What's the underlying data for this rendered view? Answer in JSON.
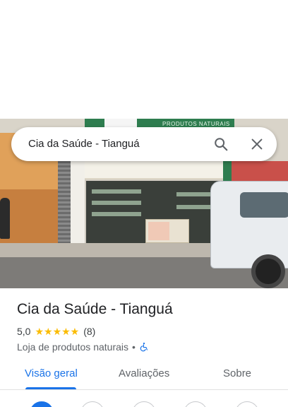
{
  "search": {
    "query": "Cia da Saúde - Tianguá",
    "search_icon": "search-icon",
    "close_icon": "close-icon"
  },
  "hero": {
    "storefront_sign": "PRODUTOS NATURAIS"
  },
  "place": {
    "title": "Cia da Saúde - Tianguá",
    "rating": "5,0",
    "stars": "★★★★★",
    "review_count": "(8)",
    "category": "Loja de produtos naturais",
    "separator": "•",
    "accessibility_icon": "wheelchair-icon"
  },
  "tabs": [
    {
      "label": "Visão geral",
      "active": true
    },
    {
      "label": "Avaliações",
      "active": false
    },
    {
      "label": "Sobre",
      "active": false
    }
  ],
  "colors": {
    "accent": "#1a73e8",
    "star": "#fbbc04",
    "text": "#202124",
    "secondary_text": "#5f6368"
  }
}
